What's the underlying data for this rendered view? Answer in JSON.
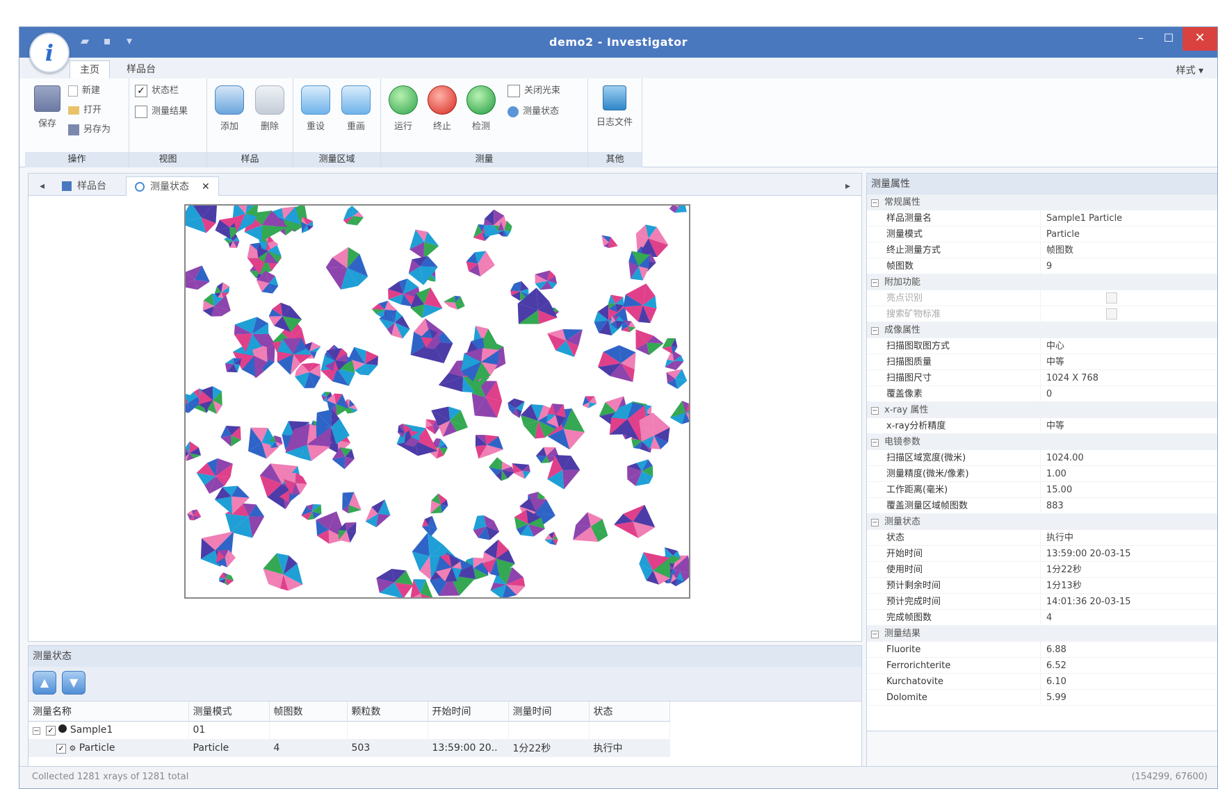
{
  "window": {
    "title": "demo2 - Investigator",
    "logo_letter": "i",
    "minimize": "–",
    "maximize": "☐",
    "close": "✕"
  },
  "ribbon_tabs": {
    "home": "主页",
    "sample_stage": "样品台",
    "style_menu": "样式 ▾"
  },
  "ribbon": {
    "operations": {
      "label": "操作",
      "save": "保存",
      "new": "新建",
      "open": "打开",
      "save_as": "另存为"
    },
    "view": {
      "label": "视图",
      "statusbar": "状态栏",
      "results": "测量结果"
    },
    "sample": {
      "label": "样品",
      "add": "添加",
      "delete": "删除"
    },
    "region": {
      "label": "测量区域",
      "reset": "重设",
      "redraw": "重画"
    },
    "measure": {
      "label": "测量",
      "run": "运行",
      "stop": "终止",
      "check": "检测",
      "close_beam": "关闭光束",
      "measure_state": "测量状态"
    },
    "other": {
      "label": "其他",
      "log_file": "日志文件"
    }
  },
  "doc_tabs": {
    "stage": "样品台",
    "status": "测量状态"
  },
  "status_panel": {
    "title": "测量状态",
    "columns": [
      "测量名称",
      "测量模式",
      "帧图数",
      "颗粒数",
      "开始时间",
      "测量时间",
      "状态"
    ],
    "rows": [
      {
        "name": "Sample1",
        "mode": "01",
        "frames": "",
        "particles": "",
        "start": "",
        "duration": "",
        "state": ""
      },
      {
        "name": "Particle",
        "mode": "Particle",
        "frames": "4",
        "particles": "503",
        "start": "13:59:00 20..",
        "duration": "1分22秒",
        "state": "执行中"
      }
    ]
  },
  "properties": {
    "title": "测量属性",
    "sections": [
      {
        "name": "常规属性",
        "rows": [
          [
            "样品测量名",
            "Sample1 Particle"
          ],
          [
            "测量模式",
            "Particle"
          ],
          [
            "终止测量方式",
            "帧图数"
          ],
          [
            "帧图数",
            "9"
          ]
        ]
      },
      {
        "name": "附加功能",
        "disabled": true,
        "rows": [
          [
            "亮点识别",
            ""
          ],
          [
            "搜索矿物标准",
            ""
          ]
        ]
      },
      {
        "name": "成像属性",
        "rows": [
          [
            "扫描图取图方式",
            "中心"
          ],
          [
            "扫描图质量",
            "中等"
          ],
          [
            "扫描图尺寸",
            "1024 X 768"
          ],
          [
            "覆盖像素",
            "0"
          ]
        ]
      },
      {
        "name": "x-ray 属性",
        "rows": [
          [
            "x-ray分析精度",
            "中等"
          ]
        ]
      },
      {
        "name": "电镜参数",
        "rows": [
          [
            "扫描区域宽度(微米)",
            "1024.00"
          ],
          [
            "测量精度(微米/像素)",
            "1.00"
          ],
          [
            "工作距离(毫米)",
            "15.00"
          ],
          [
            "覆盖测量区域帧图数",
            "883"
          ]
        ]
      },
      {
        "name": "测量状态",
        "rows": [
          [
            "状态",
            "执行中"
          ],
          [
            "开始时间",
            "13:59:00 20-03-15"
          ],
          [
            "使用时间",
            "1分22秒"
          ],
          [
            "预计剩余时间",
            "1分13秒"
          ],
          [
            "预计完成时间",
            "14:01:36 20-03-15"
          ],
          [
            "完成帧图数",
            "4"
          ]
        ]
      },
      {
        "name": "测量结果",
        "rows": [
          [
            "Fluorite",
            "6.88"
          ],
          [
            "Ferrorichterite",
            "6.52"
          ],
          [
            "Kurchatovite",
            "6.10"
          ],
          [
            "Dolomite",
            "5.99"
          ]
        ]
      }
    ]
  },
  "statusbar": {
    "left": "Collected 1281 xrays of 1281 total",
    "right": "(154299, 67600)"
  },
  "colors": {
    "titlebar": "#4a78bf",
    "particle_palette": [
      "#2f64c7",
      "#e0408a",
      "#34a853",
      "#8e44ad",
      "#f07fb5",
      "#1f9fd6",
      "#4b3ca8"
    ]
  }
}
